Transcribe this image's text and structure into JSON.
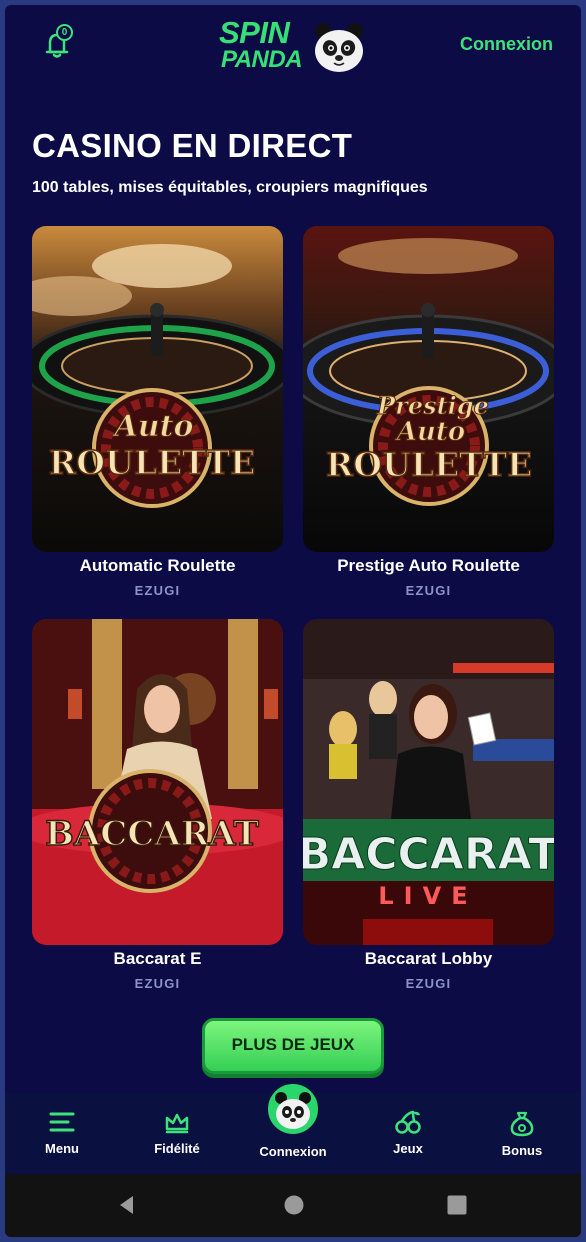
{
  "header": {
    "notification_count": "0",
    "logo_line1": "SPIN",
    "logo_line2": "PANDA",
    "login_label": "Connexion"
  },
  "section": {
    "title": "CASINO EN DIRECT",
    "subtitle": "100 tables, mises équitables, croupiers magnifiques"
  },
  "games": [
    {
      "name": "Automatic Roulette",
      "provider": "EZUGI",
      "art_line1": "Auto",
      "art_line2": "ROULETTE"
    },
    {
      "name": "Prestige Auto Roulette",
      "provider": "EZUGI",
      "art_line0": "Prestige",
      "art_line1": "Auto",
      "art_line2": "ROULETTE"
    },
    {
      "name": "Baccarat E",
      "provider": "EZUGI",
      "art_line1": "BACCARAT"
    },
    {
      "name": "Baccarat Lobby",
      "provider": "EZUGI",
      "art_line1": "BACCARAT",
      "art_line2": "LIVE"
    }
  ],
  "more_button": "PLUS DE JEUX",
  "nav": {
    "items": [
      {
        "label": "Menu",
        "icon": "menu-icon"
      },
      {
        "label": "Fidélité",
        "icon": "crown-icon"
      },
      {
        "label": "Connexion",
        "icon": "panda-avatar"
      },
      {
        "label": "Jeux",
        "icon": "cherries-icon"
      },
      {
        "label": "Bonus",
        "icon": "money-bag-icon"
      }
    ]
  },
  "colors": {
    "background": "#0c0b45",
    "accent": "#3de27a",
    "provider_text": "#8c93c9"
  }
}
